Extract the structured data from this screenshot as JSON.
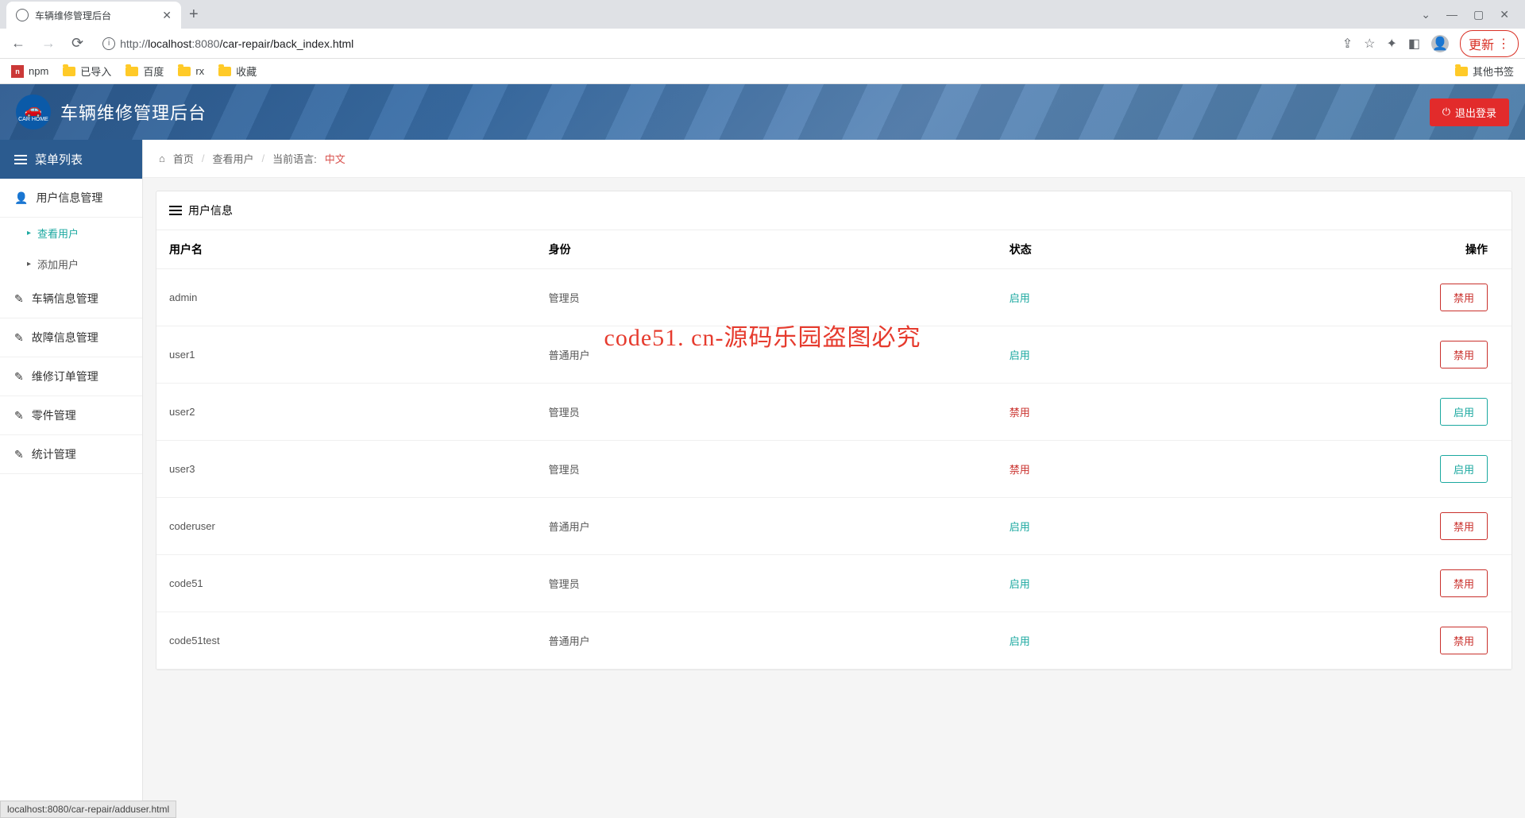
{
  "browser": {
    "tab_title": "车辆维修管理后台",
    "new_tab": "+",
    "url_prefix": "http://",
    "url_host": "localhost",
    "url_port": ":8080",
    "url_path": "/car-repair/back_index.html",
    "update_label": "更新",
    "win_min": "—",
    "win_max": "▢",
    "win_close": "✕",
    "dropdown": "⌄"
  },
  "bookmarks": {
    "npm": "npm",
    "imported": "已导入",
    "baidu": "百度",
    "rx": "rx",
    "fav": "收藏",
    "other": "其他书签"
  },
  "header": {
    "title": "车辆维修管理后台",
    "logo_text": "CAR HOME",
    "logout": "退出登录"
  },
  "sidebar": {
    "menu_title": "菜单列表",
    "items": [
      {
        "label": "用户信息管理",
        "icon": "user"
      },
      {
        "label": "车辆信息管理",
        "icon": "edit"
      },
      {
        "label": "故障信息管理",
        "icon": "edit"
      },
      {
        "label": "维修订单管理",
        "icon": "edit"
      },
      {
        "label": "零件管理",
        "icon": "edit"
      },
      {
        "label": "统计管理",
        "icon": "edit"
      }
    ],
    "submenu": [
      {
        "label": "查看用户",
        "active": true
      },
      {
        "label": "添加用户",
        "active": false
      }
    ]
  },
  "breadcrumb": {
    "home": "首页",
    "current": "查看用户",
    "lang_label": "当前语言:",
    "lang_value": "中文"
  },
  "panel": {
    "title": "用户信息",
    "columns": {
      "username": "用户名",
      "role": "身份",
      "status": "状态",
      "action": "操作"
    },
    "status_labels": {
      "enabled": "启用",
      "disabled": "禁用"
    },
    "action_labels": {
      "disable": "禁用",
      "enable": "启用"
    },
    "rows": [
      {
        "username": "admin",
        "role": "管理员",
        "status": "enabled"
      },
      {
        "username": "user1",
        "role": "普通用户",
        "status": "enabled"
      },
      {
        "username": "user2",
        "role": "管理员",
        "status": "disabled"
      },
      {
        "username": "user3",
        "role": "管理员",
        "status": "disabled"
      },
      {
        "username": "coderuser",
        "role": "普通用户",
        "status": "enabled"
      },
      {
        "username": "code51",
        "role": "管理员",
        "status": "enabled"
      },
      {
        "username": "code51test",
        "role": "普通用户",
        "status": "enabled"
      }
    ]
  },
  "watermark": "code51. cn-源码乐园盗图必究",
  "status_bar": "localhost:8080/car-repair/adduser.html"
}
